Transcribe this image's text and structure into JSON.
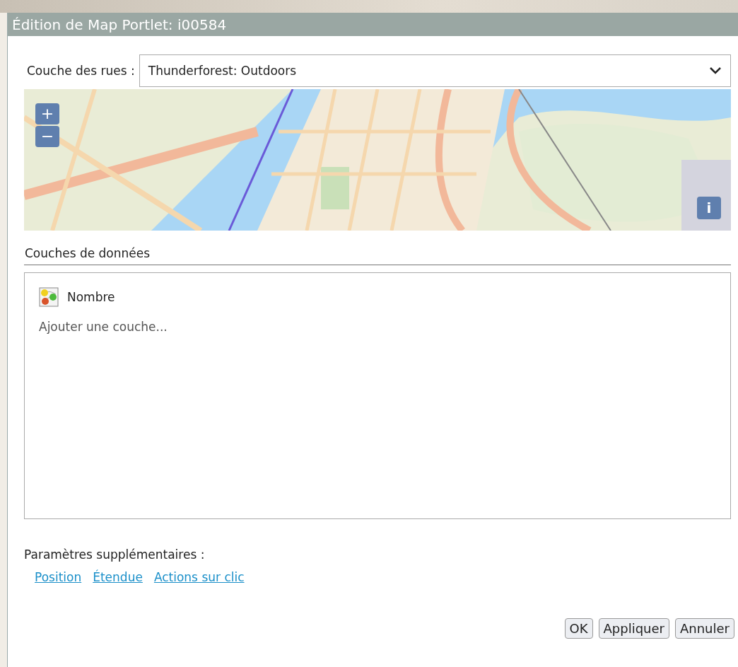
{
  "window": {
    "title": "Édition de Map Portlet: i00584"
  },
  "street_layer": {
    "label": "Couche des rues :",
    "value": "Thunderforest: Outdoors"
  },
  "map": {
    "kind": "picture",
    "zoom_in": "+",
    "zoom_out": "−",
    "info": "i"
  },
  "data_layers": {
    "heading": "Couches de données",
    "items": [
      {
        "label": "Nombre"
      }
    ],
    "add": "Ajouter une couche..."
  },
  "extra": {
    "label": "Paramètres supplémentaires :",
    "links": [
      "Position",
      "Étendue",
      "Actions sur clic"
    ]
  },
  "buttons": [
    "OK",
    "Appliquer",
    "Annuler"
  ]
}
